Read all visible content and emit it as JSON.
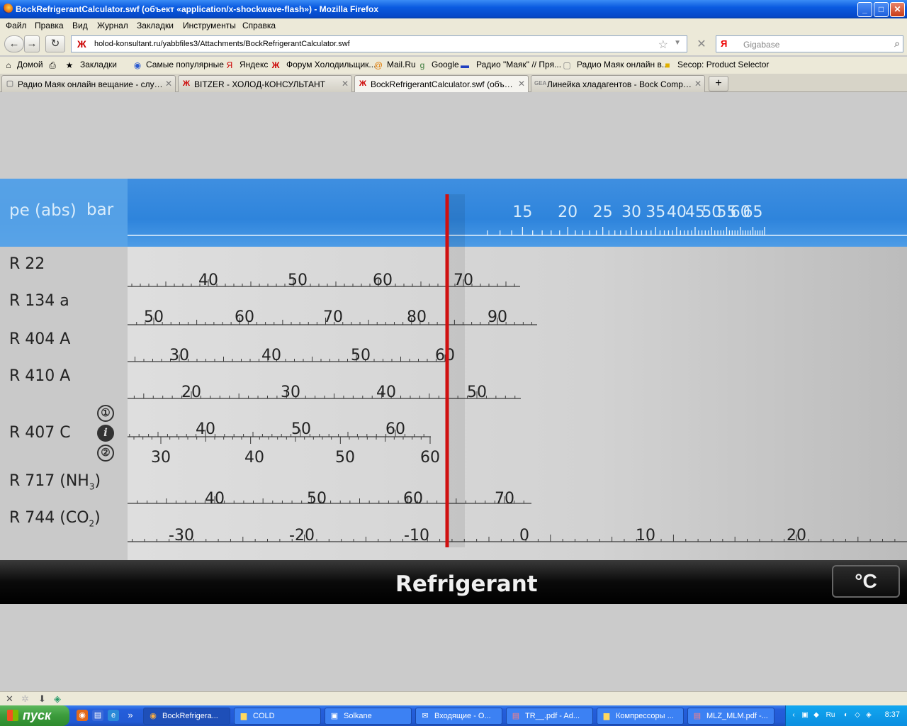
{
  "window": {
    "title": "BockRefrigerantCalculator.swf (объект «application/x-shockwave-flash») - Mozilla Firefox",
    "minimize": "_",
    "maximize": "□",
    "close": "✕"
  },
  "menu": [
    "Файл",
    "Правка",
    "Вид",
    "Журнал",
    "Закладки",
    "Инструменты",
    "Справка"
  ],
  "nav": {
    "back": "←",
    "forward": "→",
    "reload": "↻",
    "url": "holod-konsultant.ru/yabbfiles3/Attachments/BockRefrigerantCalculator.swf",
    "site_icon": "Ж",
    "search_engine_icon": "Я",
    "search_placeholder": "Gigabase",
    "stop": "✕"
  },
  "bookmarks": [
    {
      "label": "Домой",
      "icon": "home-icon"
    },
    {
      "label": "",
      "icon": "print-icon"
    },
    {
      "label": "Закладки",
      "icon": "bookmarks-icon"
    },
    {
      "label": "Самые популярные",
      "icon": "popular-icon"
    },
    {
      "label": "Яндекс",
      "icon": "yandex-icon"
    },
    {
      "label": "Форум Холодильщик...",
      "icon": "forum-icon"
    },
    {
      "label": "Mail.Ru",
      "icon": "mail-icon"
    },
    {
      "label": "Google",
      "icon": "google-icon"
    },
    {
      "label": "Радио \"Маяк\" // Пря...",
      "icon": "radio-icon"
    },
    {
      "label": "Радио Маяк онлайн в...",
      "icon": "page-icon"
    },
    {
      "label": "Secop: Product Selector",
      "icon": "secop-icon"
    }
  ],
  "tabs": [
    {
      "label": "Радио Маяк онлайн вещание - слушать...",
      "active": false
    },
    {
      "label": "BITZER - ХОЛОД-КОНСУЛЬТАНТ",
      "active": false
    },
    {
      "label": "BockRefrigerantCalculator.swf (объект «a...",
      "active": true
    },
    {
      "label": "Линейка хладагентов - Bock Compressors",
      "active": false
    }
  ],
  "calculator": {
    "pressure_label": "pe (abs)",
    "pressure_unit": "bar",
    "pressure_ticks": [
      "15",
      "20",
      "25",
      "30",
      "35",
      "40",
      "45",
      "50",
      "55",
      "60",
      "65"
    ],
    "refrigerants": [
      {
        "name": "R 22",
        "labels": [
          "40",
          "50",
          "60",
          "70"
        ]
      },
      {
        "name": "R 134 a",
        "labels": [
          "50",
          "60",
          "70",
          "80",
          "90"
        ]
      },
      {
        "name": "R 404 A",
        "labels": [
          "30",
          "40",
          "50",
          "60"
        ]
      },
      {
        "name": "R 410 A",
        "labels": [
          "20",
          "30",
          "40",
          "50"
        ]
      },
      {
        "name": "R 407 C",
        "labels_top": [
          "40",
          "50",
          "60"
        ],
        "labels_bottom": [
          "30",
          "40",
          "50",
          "60"
        ]
      },
      {
        "name": "R 717 (NH",
        "sub": "3",
        "suffix": ")",
        "labels": [
          "40",
          "50",
          "60",
          "70"
        ]
      },
      {
        "name": "R 744 (CO",
        "sub": "2",
        "suffix": ")",
        "labels": [
          "-30",
          "-20",
          "-10",
          "0",
          "10",
          "20"
        ]
      }
    ],
    "circle_one": "①",
    "circle_info": "i",
    "circle_two": "②",
    "title": "Refrigerant",
    "unit_button": "°C",
    "cursor_color": "#d01010"
  },
  "statusbar": {
    "close": "✕",
    "download": "⬇"
  },
  "taskbar": {
    "start": "пуск",
    "tasks": [
      {
        "label": "BockRefrigera...",
        "active": true,
        "icon": "firefox-icon"
      },
      {
        "label": "COLD",
        "active": false,
        "icon": "folder-icon"
      },
      {
        "label": "Solkane",
        "active": false,
        "icon": "app-icon"
      },
      {
        "label": "Входящие - О...",
        "active": false,
        "icon": "mail-icon"
      },
      {
        "label": "TR__.pdf - Ad...",
        "active": false,
        "icon": "pdf-icon"
      },
      {
        "label": "Компрессоры ...",
        "active": false,
        "icon": "folder-icon"
      },
      {
        "label": "MLZ_MLM.pdf -...",
        "active": false,
        "icon": "pdf-icon"
      }
    ],
    "tray_lang": "Ru",
    "clock": "8:37"
  }
}
